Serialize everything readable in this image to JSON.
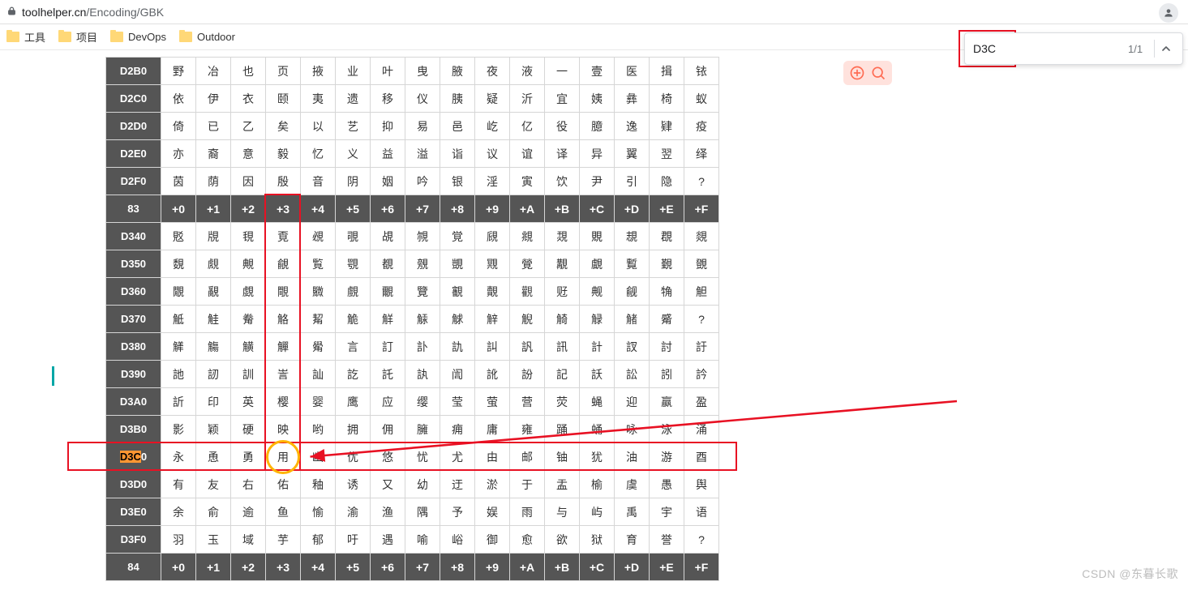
{
  "addr": {
    "host": "toolhelper.cn",
    "path": "/Encoding/GBK"
  },
  "user_badge": "⦿",
  "bookmarks": [
    {
      "label": "工具"
    },
    {
      "label": "项目"
    },
    {
      "label": "DevOps"
    },
    {
      "label": "Outdoor"
    }
  ],
  "findbar": {
    "query": "D3C",
    "hits": "1/1"
  },
  "float_tool": {
    "label": "🅐  🔍"
  },
  "watermark": "CSDN @东暮长歌",
  "col_offsets": [
    "+0",
    "+1",
    "+2",
    "+3",
    "+4",
    "+5",
    "+6",
    "+7",
    "+8",
    "+9",
    "+A",
    "+B",
    "+C",
    "+D",
    "+E",
    "+F"
  ],
  "rows": [
    {
      "head": "D2B0",
      "cells": [
        "野",
        "冶",
        "也",
        "页",
        "掖",
        "业",
        "叶",
        "曳",
        "腋",
        "夜",
        "液",
        "一",
        "壹",
        "医",
        "揖",
        "铱"
      ]
    },
    {
      "head": "D2C0",
      "cells": [
        "依",
        "伊",
        "衣",
        "颐",
        "夷",
        "遗",
        "移",
        "仪",
        "胰",
        "疑",
        "沂",
        "宜",
        "姨",
        "彝",
        "椅",
        "蚁"
      ]
    },
    {
      "head": "D2D0",
      "cells": [
        "倚",
        "已",
        "乙",
        "矣",
        "以",
        "艺",
        "抑",
        "易",
        "邑",
        "屹",
        "亿",
        "役",
        "臆",
        "逸",
        "肄",
        "疫"
      ]
    },
    {
      "head": "D2E0",
      "cells": [
        "亦",
        "裔",
        "意",
        "毅",
        "忆",
        "义",
        "益",
        "溢",
        "诣",
        "议",
        "谊",
        "译",
        "异",
        "翼",
        "翌",
        "绎"
      ]
    },
    {
      "head": "D2F0",
      "cells": [
        "茵",
        "荫",
        "因",
        "殷",
        "音",
        "阴",
        "姻",
        "吟",
        "银",
        "淫",
        "寅",
        "饮",
        "尹",
        "引",
        "隐",
        "?"
      ]
    },
    {
      "head": "83",
      "cells": "__COLHEAD__"
    },
    {
      "head": "D340",
      "cells": [
        "覐",
        "覑",
        "覒",
        "覔",
        "覕",
        "覗",
        "覘",
        "覙",
        "覚",
        "覛",
        "覜",
        "覝",
        "覞",
        "覟",
        "覠",
        "覢"
      ]
    },
    {
      "head": "D350",
      "cells": [
        "覣",
        "覤",
        "覥",
        "覦",
        "覧",
        "覨",
        "覩",
        "覫",
        "覬",
        "覭",
        "覮",
        "覯",
        "覰",
        "覱",
        "覲",
        "覴"
      ]
    },
    {
      "head": "D360",
      "cells": [
        "覵",
        "覶",
        "覷",
        "覸",
        "覹",
        "覻",
        "覼",
        "覽",
        "覾",
        "覿",
        "觀",
        "觃",
        "觍",
        "觎",
        "觕",
        "觛"
      ]
    },
    {
      "head": "D370",
      "cells": [
        "觝",
        "觟",
        "觠",
        "觡",
        "觢",
        "觤",
        "觧",
        "觨",
        "觩",
        "觪",
        "觬",
        "觭",
        "觮",
        "觰",
        "觱",
        "?"
      ]
    },
    {
      "head": "D380",
      "cells": [
        "觲",
        "觴",
        "觵",
        "觶",
        "觷",
        "言",
        "訂",
        "訃",
        "訅",
        "訆",
        "訉",
        "訊",
        "計",
        "訍",
        "討",
        "訏"
      ]
    },
    {
      "head": "D390",
      "cells": [
        "訑",
        "訒",
        "訓",
        "訔",
        "訕",
        "訖",
        "託",
        "訙",
        "訚",
        "訛",
        "訜",
        "記",
        "訞",
        "訟",
        "訠",
        "訡"
      ]
    },
    {
      "head": "D3A0",
      "cells": [
        "訢",
        "印",
        "英",
        "樱",
        "婴",
        "鹰",
        "应",
        "缨",
        "莹",
        "萤",
        "营",
        "荧",
        "蝇",
        "迎",
        "赢",
        "盈"
      ]
    },
    {
      "head": "D3B0",
      "cells": [
        "影",
        "颖",
        "硬",
        "映",
        "哟",
        "拥",
        "佣",
        "臃",
        "痈",
        "庸",
        "雍",
        "踊",
        "蛹",
        "咏",
        "泳",
        "涌"
      ]
    },
    {
      "head": "D3C0",
      "cells": [
        "永",
        "恿",
        "勇",
        "用",
        "幽",
        "优",
        "悠",
        "忧",
        "尤",
        "由",
        "邮",
        "铀",
        "犹",
        "油",
        "游",
        "酉"
      ]
    },
    {
      "head": "D3D0",
      "cells": [
        "有",
        "友",
        "右",
        "佑",
        "釉",
        "诱",
        "又",
        "幼",
        "迂",
        "淤",
        "于",
        "盂",
        "榆",
        "虞",
        "愚",
        "舆"
      ]
    },
    {
      "head": "D3E0",
      "cells": [
        "余",
        "俞",
        "逾",
        "鱼",
        "愉",
        "渝",
        "渔",
        "隅",
        "予",
        "娱",
        "雨",
        "与",
        "屿",
        "禹",
        "宇",
        "语"
      ]
    },
    {
      "head": "D3F0",
      "cells": [
        "羽",
        "玉",
        "域",
        "芋",
        "郁",
        "吁",
        "遇",
        "喻",
        "峪",
        "御",
        "愈",
        "欲",
        "狱",
        "育",
        "誉",
        "?"
      ]
    },
    {
      "head": "84",
      "cells": "__COLHEAD__"
    }
  ],
  "highlight": {
    "row_head_text": "D3C",
    "target_char": "用"
  }
}
